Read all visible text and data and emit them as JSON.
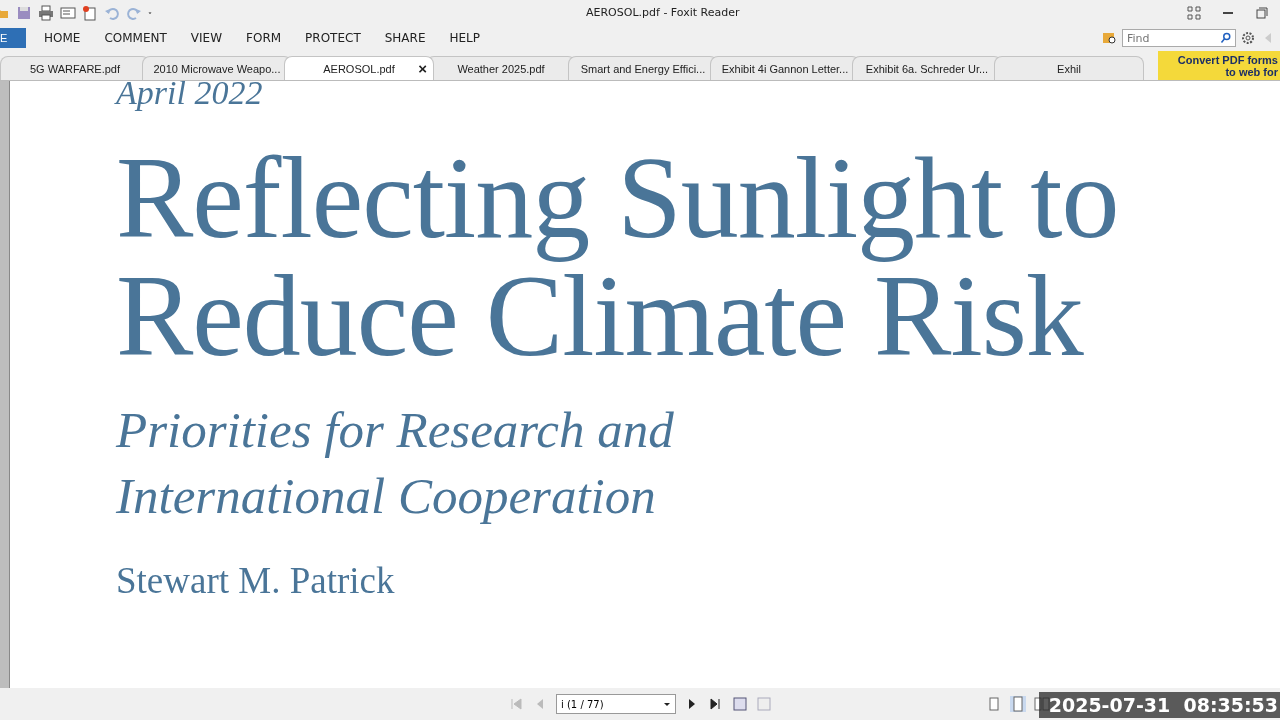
{
  "window": {
    "title": "AEROSOL.pdf - Foxit Reader"
  },
  "ribbon": {
    "file_tab": "E",
    "tabs": [
      {
        "label": "HOME",
        "selected": false
      },
      {
        "label": "COMMENT",
        "selected": false
      },
      {
        "label": "VIEW",
        "selected": false
      },
      {
        "label": "FORM",
        "selected": false
      },
      {
        "label": "PROTECT",
        "selected": false
      },
      {
        "label": "SHARE",
        "selected": false
      },
      {
        "label": "HELP",
        "selected": false
      }
    ],
    "find": {
      "placeholder": "Find"
    }
  },
  "doc_tabs": [
    {
      "label": "5G WARFARE.pdf",
      "selected": false
    },
    {
      "label": "2010 Microwave Weapo...",
      "selected": false
    },
    {
      "label": "AEROSOL.pdf",
      "selected": true,
      "close": "×"
    },
    {
      "label": "Weather 2025.pdf",
      "selected": false
    },
    {
      "label": "Smart and Energy Effici...",
      "selected": false
    },
    {
      "label": "Exhibit 4i Gannon Letter...",
      "selected": false
    },
    {
      "label": "Exhibit 6a. Schreder Ur...",
      "selected": false
    },
    {
      "label": "Exhil",
      "selected": false
    }
  ],
  "ad_banner": {
    "lines": [
      "Convert PDF forms",
      "to web for"
    ]
  },
  "document": {
    "date": "April 2022",
    "title_lines": [
      "Reflecting Sunlight to",
      "Reduce Climate Risk"
    ],
    "subtitle_lines": [
      "Priorities for Research and",
      "International Cooperation"
    ],
    "author": "Stewart M. Patrick"
  },
  "status_bar": {
    "page_field": "i (1 / 77)"
  },
  "overlay_timestamp": "2025-07-31  08:35:53"
}
